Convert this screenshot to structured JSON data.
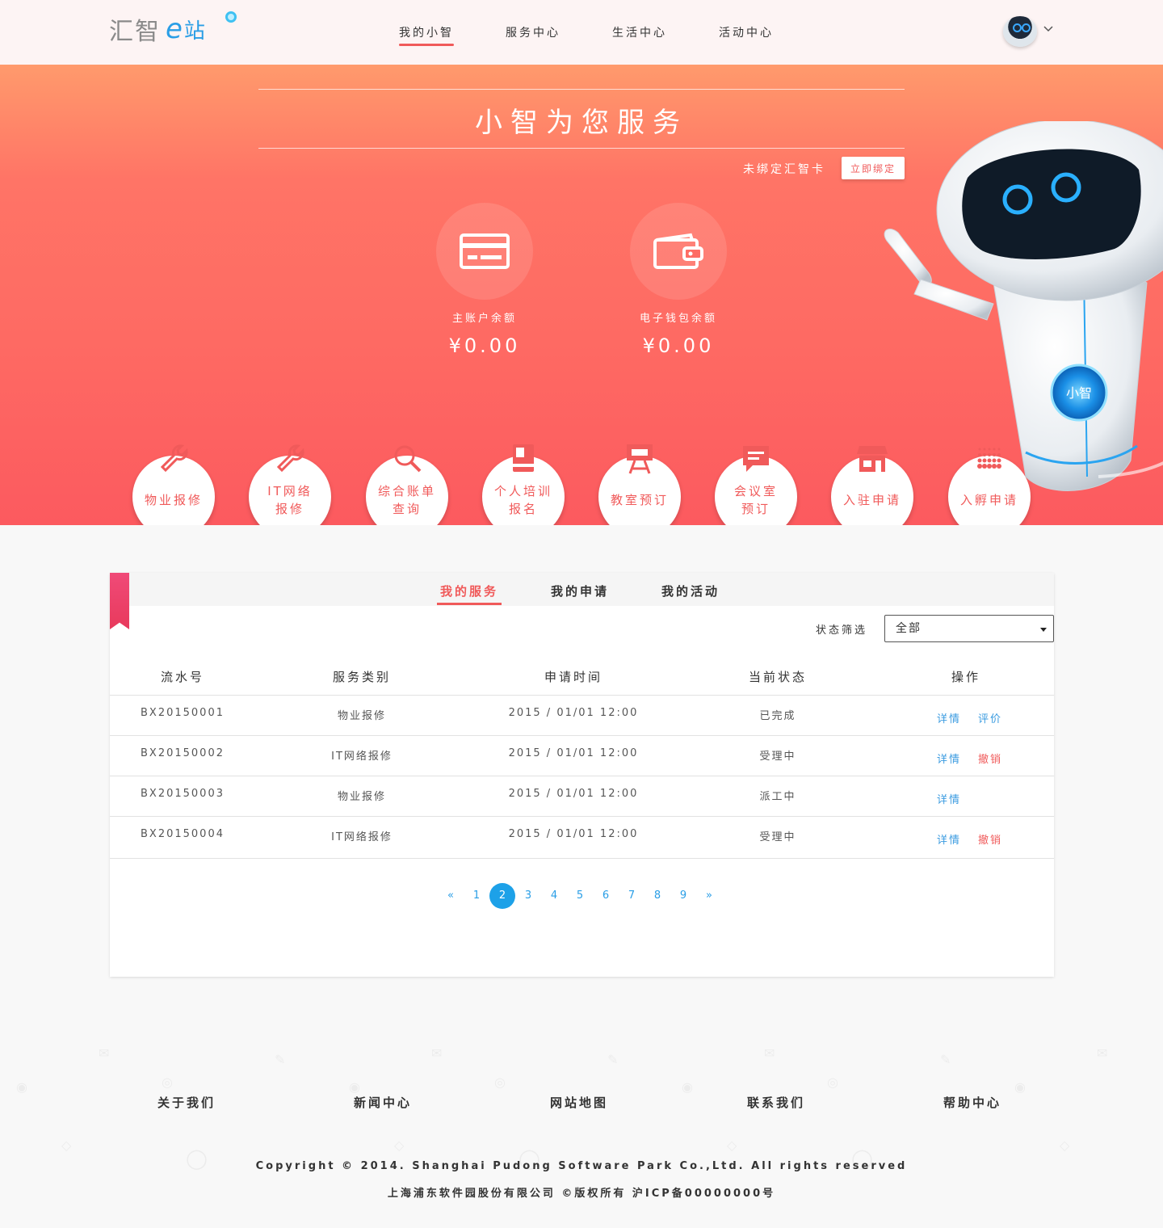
{
  "header": {
    "logo": {
      "part1": "汇智",
      "part2": "e",
      "part3": "站"
    },
    "nav": [
      {
        "label": "我的小智",
        "active": true
      },
      {
        "label": "服务中心",
        "active": false
      },
      {
        "label": "生活中心",
        "active": false
      },
      {
        "label": "活动中心",
        "active": false
      }
    ],
    "avatar_icon": "robot-avatar-icon",
    "dropdown_icon": "chevron-down-icon"
  },
  "hero": {
    "title": "小智为您服务",
    "bind_text": "未绑定汇智卡",
    "bind_button": "立即绑定",
    "balances": [
      {
        "icon": "card-icon",
        "label": "主账户余额",
        "value": "¥0.00"
      },
      {
        "icon": "wallet-icon",
        "label": "电子钱包余额",
        "value": "¥0.00"
      }
    ],
    "robot_badge": "小智"
  },
  "services": [
    {
      "line1": "物业报修",
      "line2": "",
      "icon": "wrench-icon"
    },
    {
      "line1": "IT网络",
      "line2": "报修",
      "icon": "wrench-icon"
    },
    {
      "line1": "综合账单",
      "line2": "查询",
      "icon": "magnifier-icon"
    },
    {
      "line1": "个人培训",
      "line2": "报名",
      "icon": "book-icon"
    },
    {
      "line1": "教室预订",
      "line2": "",
      "icon": "easel-icon"
    },
    {
      "line1": "会议室",
      "line2": "预订",
      "icon": "chat-icon"
    },
    {
      "line1": "入驻申请",
      "line2": "",
      "icon": "store-icon"
    },
    {
      "line1": "入孵申请",
      "line2": "",
      "icon": "dots-icon"
    }
  ],
  "panel": {
    "tabs": [
      {
        "label": "我的服务",
        "active": true
      },
      {
        "label": "我的申请",
        "active": false
      },
      {
        "label": "我的活动",
        "active": false
      }
    ],
    "filter_label": "状态筛选",
    "filter_value": "全部",
    "columns": [
      "流水号",
      "服务类别",
      "申请时间",
      "当前状态",
      "操作"
    ],
    "rows": [
      {
        "id": "BX20150001",
        "category": "物业报修",
        "time": "2015 / 01/01 12:00",
        "status": "已完成",
        "action1": "详情",
        "action2": "评价",
        "action2_color": "blue"
      },
      {
        "id": "BX20150002",
        "category": "IT网络报修",
        "time": "2015 / 01/01 12:00",
        "status": "受理中",
        "action1": "详情",
        "action2": "撤销",
        "action2_color": "red"
      },
      {
        "id": "BX20150003",
        "category": "物业报修",
        "time": "2015 / 01/01 12:00",
        "status": "派工中",
        "action1": "详情",
        "action2": "",
        "action2_color": "blue"
      },
      {
        "id": "BX20150004",
        "category": "IT网络报修",
        "time": "2015 / 01/01 12:00",
        "status": "受理中",
        "action1": "详情",
        "action2": "撤销",
        "action2_color": "red"
      }
    ],
    "pagination": {
      "prev": "«",
      "pages": [
        "1",
        "2",
        "3",
        "4",
        "5",
        "6",
        "7",
        "8",
        "9"
      ],
      "current": "2",
      "next": "»"
    }
  },
  "footer": {
    "links": [
      "关于我们",
      "新闻中心",
      "网站地图",
      "联系我们",
      "帮助中心"
    ],
    "copyright": "Copyright © 2014. Shanghai Pudong Software Park Co.,Ltd. All rights reserved",
    "icp": "上海浦东软件园股份有限公司 ©版权所有 沪ICP备00000000号"
  },
  "colors": {
    "accent": "#f05a5a",
    "link": "#3a9be0",
    "hero_top": "#ff9a6c",
    "hero_bottom": "#fc5a5f"
  }
}
